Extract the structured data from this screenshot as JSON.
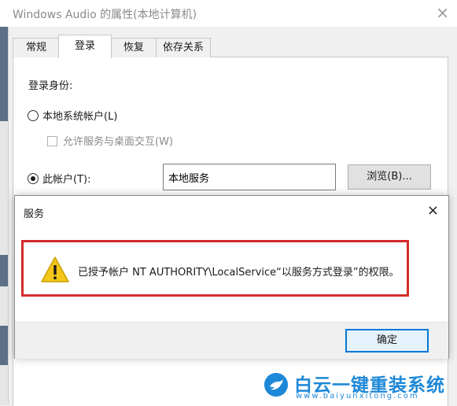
{
  "window": {
    "title": "Windows Audio 的属性(本地计算机)",
    "close_glyph": "×"
  },
  "tabs": [
    {
      "label": "常规",
      "active": false
    },
    {
      "label": "登录",
      "active": true
    },
    {
      "label": "恢复",
      "active": false
    },
    {
      "label": "依存关系",
      "active": false
    }
  ],
  "login": {
    "heading": "登录身份:",
    "local_system_label": "本地系统帐户(L)",
    "allow_desktop_label": "允许服务与桌面交互(W)",
    "this_account_label": "此帐户(T):",
    "account_value": "本地服务",
    "browse_label": "浏览(B)..."
  },
  "dialog": {
    "title": "服务",
    "close_glyph": "×",
    "message": "已授予帐户 NT AUTHORITY\\LocalService“以服务方式登录”的权限。",
    "ok_label": "确定",
    "icon": "warning-icon"
  },
  "watermark": {
    "title": "白云一键重装系统",
    "url": "www.baiyunxitong.com"
  },
  "colors": {
    "highlight": "#d42a2a",
    "accent": "#0078d7",
    "watermark": "#1e88d8",
    "warning": "#f5c518"
  }
}
